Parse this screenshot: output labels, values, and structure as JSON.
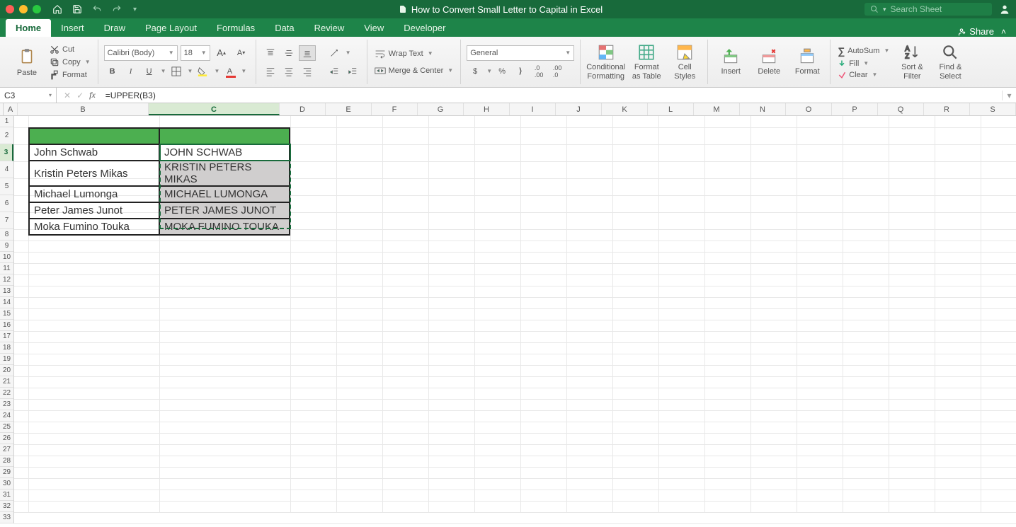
{
  "window": {
    "title": "How to Convert Small Letter to Capital in Excel",
    "search_placeholder": "Search Sheet",
    "share_label": "Share"
  },
  "tabs": [
    "Home",
    "Insert",
    "Draw",
    "Page Layout",
    "Formulas",
    "Data",
    "Review",
    "View",
    "Developer"
  ],
  "active_tab": "Home",
  "ribbon": {
    "paste": "Paste",
    "cut": "Cut",
    "copy": "Copy",
    "format_painter": "Format",
    "font_name": "Calibri (Body)",
    "font_size": "18",
    "wrap_text": "Wrap Text",
    "merge_center": "Merge & Center",
    "number_format": "General",
    "cond_fmt": "Conditional\nFormatting",
    "fmt_table": "Format\nas Table",
    "cell_styles": "Cell\nStyles",
    "insert": "Insert",
    "delete": "Delete",
    "format": "Format",
    "autosum": "AutoSum",
    "fill": "Fill",
    "clear": "Clear",
    "sort_filter": "Sort &\nFilter",
    "find_select": "Find &\nSelect"
  },
  "formula_bar": {
    "name_box": "C3",
    "formula": "=UPPER(B3)"
  },
  "columns": [
    "A",
    "B",
    "C",
    "D",
    "E",
    "F",
    "G",
    "H",
    "I",
    "J",
    "K",
    "L",
    "M",
    "N",
    "O",
    "P",
    "Q",
    "R",
    "S"
  ],
  "col_widths": {
    "A": 20,
    "B": 185,
    "C": 185,
    "default": 65
  },
  "tall_rows": [
    2,
    3,
    4,
    5,
    6,
    7
  ],
  "selected_col": "C",
  "selected_row": 3,
  "data": {
    "B": [
      "John Schwab",
      "Kristin Peters Mikas",
      "Michael Lumonga",
      "Peter James Junot",
      "Moka Fumino Touka"
    ],
    "C": [
      "JOHN SCHWAB",
      "KRISTIN PETERS MIKAS",
      "MICHAEL LUMONGA",
      "PETER JAMES JUNOT",
      "MOKA FUMINO TOUKA"
    ]
  },
  "icons": {
    "fx": "fx"
  }
}
